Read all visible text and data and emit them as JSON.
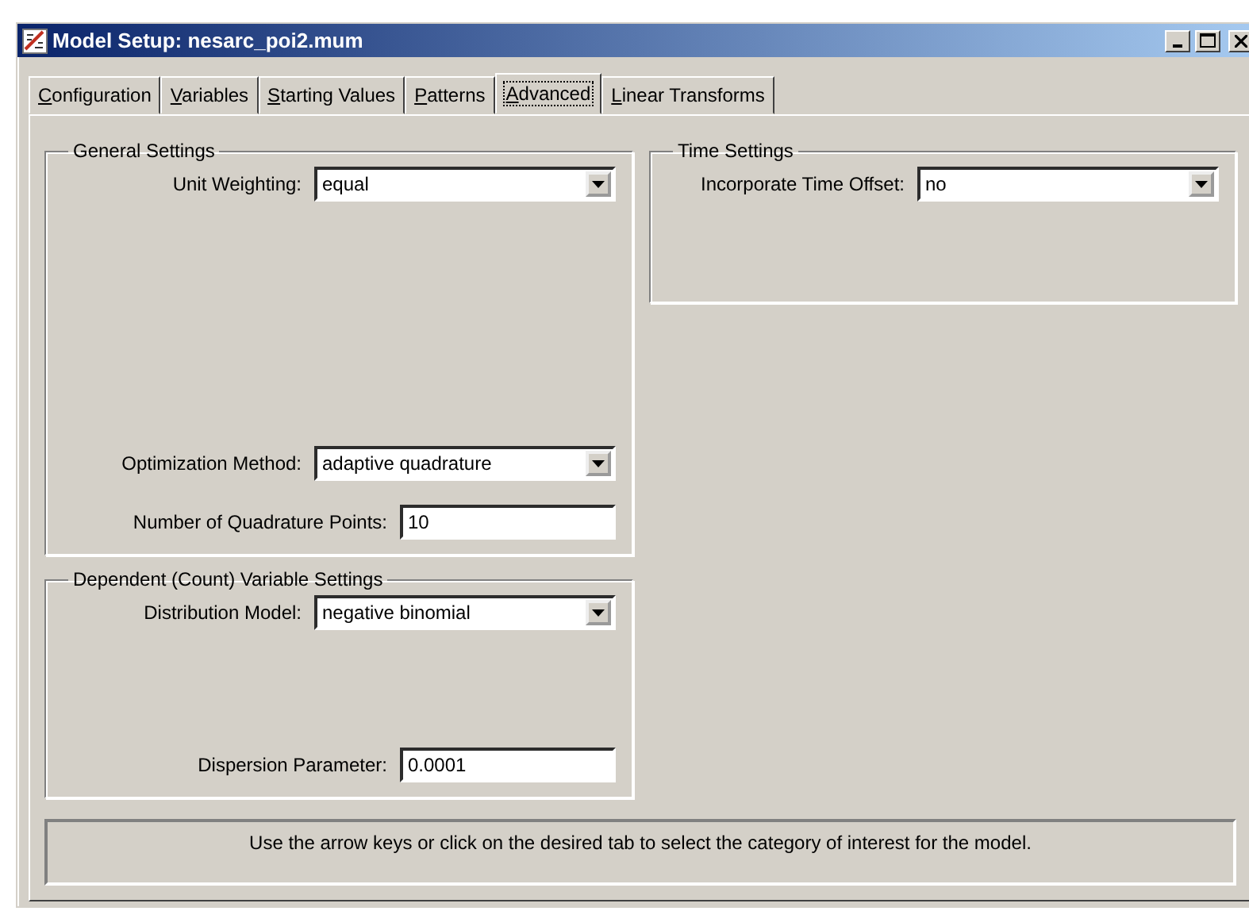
{
  "window": {
    "title": "Model Setup: nesarc_poi2.mum"
  },
  "tabs": [
    {
      "label": "Configuration",
      "selected": false
    },
    {
      "label": "Variables",
      "selected": false
    },
    {
      "label": "Starting Values",
      "selected": false
    },
    {
      "label": "Patterns",
      "selected": false
    },
    {
      "label": "Advanced",
      "selected": true
    },
    {
      "label": "Linear Transforms",
      "selected": false
    }
  ],
  "general_settings": {
    "title": "General Settings",
    "fields": [
      {
        "kind": "combo",
        "label": "Unit Weighting:",
        "value": "equal"
      },
      {
        "kind": "combo",
        "label": "Optimization Method:",
        "value": "adaptive quadrature"
      },
      {
        "kind": "text",
        "label": "Number of Quadrature Points:",
        "value": "10"
      }
    ]
  },
  "dependent_settings": {
    "title": "Dependent (Count) Variable Settings",
    "fields": [
      {
        "kind": "combo",
        "label": "Distribution Model:",
        "value": "negative binomial"
      },
      {
        "kind": "text",
        "label": "Dispersion Parameter:",
        "value": "0.0001"
      }
    ]
  },
  "time_settings": {
    "title": "Time Settings",
    "fields": [
      {
        "kind": "combo",
        "label": "Incorporate Time Offset:",
        "value": "no"
      }
    ]
  },
  "status_bar": "Use the arrow keys or click on the desired tab to select the category of interest for the model."
}
